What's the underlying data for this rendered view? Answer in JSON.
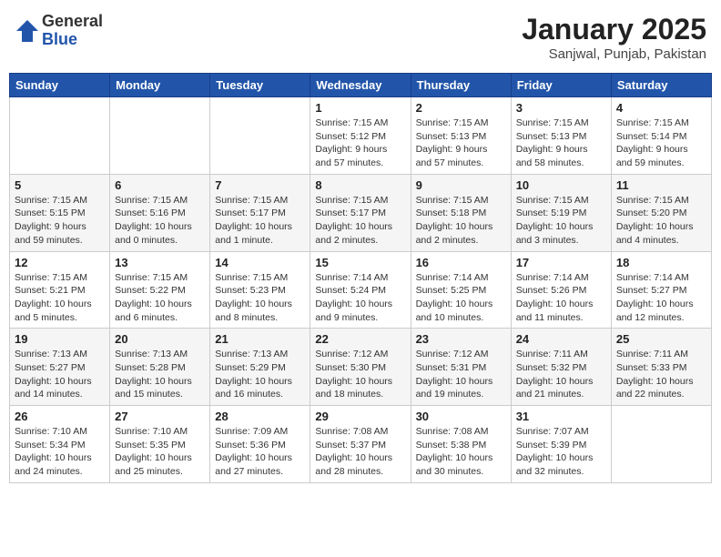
{
  "header": {
    "logo_general": "General",
    "logo_blue": "Blue",
    "title": "January 2025",
    "subtitle": "Sanjwal, Punjab, Pakistan"
  },
  "weekdays": [
    "Sunday",
    "Monday",
    "Tuesday",
    "Wednesday",
    "Thursday",
    "Friday",
    "Saturday"
  ],
  "weeks": [
    [
      {
        "day": "",
        "info": ""
      },
      {
        "day": "",
        "info": ""
      },
      {
        "day": "",
        "info": ""
      },
      {
        "day": "1",
        "info": "Sunrise: 7:15 AM\nSunset: 5:12 PM\nDaylight: 9 hours\nand 57 minutes."
      },
      {
        "day": "2",
        "info": "Sunrise: 7:15 AM\nSunset: 5:13 PM\nDaylight: 9 hours\nand 57 minutes."
      },
      {
        "day": "3",
        "info": "Sunrise: 7:15 AM\nSunset: 5:13 PM\nDaylight: 9 hours\nand 58 minutes."
      },
      {
        "day": "4",
        "info": "Sunrise: 7:15 AM\nSunset: 5:14 PM\nDaylight: 9 hours\nand 59 minutes."
      }
    ],
    [
      {
        "day": "5",
        "info": "Sunrise: 7:15 AM\nSunset: 5:15 PM\nDaylight: 9 hours\nand 59 minutes."
      },
      {
        "day": "6",
        "info": "Sunrise: 7:15 AM\nSunset: 5:16 PM\nDaylight: 10 hours\nand 0 minutes."
      },
      {
        "day": "7",
        "info": "Sunrise: 7:15 AM\nSunset: 5:17 PM\nDaylight: 10 hours\nand 1 minute."
      },
      {
        "day": "8",
        "info": "Sunrise: 7:15 AM\nSunset: 5:17 PM\nDaylight: 10 hours\nand 2 minutes."
      },
      {
        "day": "9",
        "info": "Sunrise: 7:15 AM\nSunset: 5:18 PM\nDaylight: 10 hours\nand 2 minutes."
      },
      {
        "day": "10",
        "info": "Sunrise: 7:15 AM\nSunset: 5:19 PM\nDaylight: 10 hours\nand 3 minutes."
      },
      {
        "day": "11",
        "info": "Sunrise: 7:15 AM\nSunset: 5:20 PM\nDaylight: 10 hours\nand 4 minutes."
      }
    ],
    [
      {
        "day": "12",
        "info": "Sunrise: 7:15 AM\nSunset: 5:21 PM\nDaylight: 10 hours\nand 5 minutes."
      },
      {
        "day": "13",
        "info": "Sunrise: 7:15 AM\nSunset: 5:22 PM\nDaylight: 10 hours\nand 6 minutes."
      },
      {
        "day": "14",
        "info": "Sunrise: 7:15 AM\nSunset: 5:23 PM\nDaylight: 10 hours\nand 8 minutes."
      },
      {
        "day": "15",
        "info": "Sunrise: 7:14 AM\nSunset: 5:24 PM\nDaylight: 10 hours\nand 9 minutes."
      },
      {
        "day": "16",
        "info": "Sunrise: 7:14 AM\nSunset: 5:25 PM\nDaylight: 10 hours\nand 10 minutes."
      },
      {
        "day": "17",
        "info": "Sunrise: 7:14 AM\nSunset: 5:26 PM\nDaylight: 10 hours\nand 11 minutes."
      },
      {
        "day": "18",
        "info": "Sunrise: 7:14 AM\nSunset: 5:27 PM\nDaylight: 10 hours\nand 12 minutes."
      }
    ],
    [
      {
        "day": "19",
        "info": "Sunrise: 7:13 AM\nSunset: 5:27 PM\nDaylight: 10 hours\nand 14 minutes."
      },
      {
        "day": "20",
        "info": "Sunrise: 7:13 AM\nSunset: 5:28 PM\nDaylight: 10 hours\nand 15 minutes."
      },
      {
        "day": "21",
        "info": "Sunrise: 7:13 AM\nSunset: 5:29 PM\nDaylight: 10 hours\nand 16 minutes."
      },
      {
        "day": "22",
        "info": "Sunrise: 7:12 AM\nSunset: 5:30 PM\nDaylight: 10 hours\nand 18 minutes."
      },
      {
        "day": "23",
        "info": "Sunrise: 7:12 AM\nSunset: 5:31 PM\nDaylight: 10 hours\nand 19 minutes."
      },
      {
        "day": "24",
        "info": "Sunrise: 7:11 AM\nSunset: 5:32 PM\nDaylight: 10 hours\nand 21 minutes."
      },
      {
        "day": "25",
        "info": "Sunrise: 7:11 AM\nSunset: 5:33 PM\nDaylight: 10 hours\nand 22 minutes."
      }
    ],
    [
      {
        "day": "26",
        "info": "Sunrise: 7:10 AM\nSunset: 5:34 PM\nDaylight: 10 hours\nand 24 minutes."
      },
      {
        "day": "27",
        "info": "Sunrise: 7:10 AM\nSunset: 5:35 PM\nDaylight: 10 hours\nand 25 minutes."
      },
      {
        "day": "28",
        "info": "Sunrise: 7:09 AM\nSunset: 5:36 PM\nDaylight: 10 hours\nand 27 minutes."
      },
      {
        "day": "29",
        "info": "Sunrise: 7:08 AM\nSunset: 5:37 PM\nDaylight: 10 hours\nand 28 minutes."
      },
      {
        "day": "30",
        "info": "Sunrise: 7:08 AM\nSunset: 5:38 PM\nDaylight: 10 hours\nand 30 minutes."
      },
      {
        "day": "31",
        "info": "Sunrise: 7:07 AM\nSunset: 5:39 PM\nDaylight: 10 hours\nand 32 minutes."
      },
      {
        "day": "",
        "info": ""
      }
    ]
  ]
}
